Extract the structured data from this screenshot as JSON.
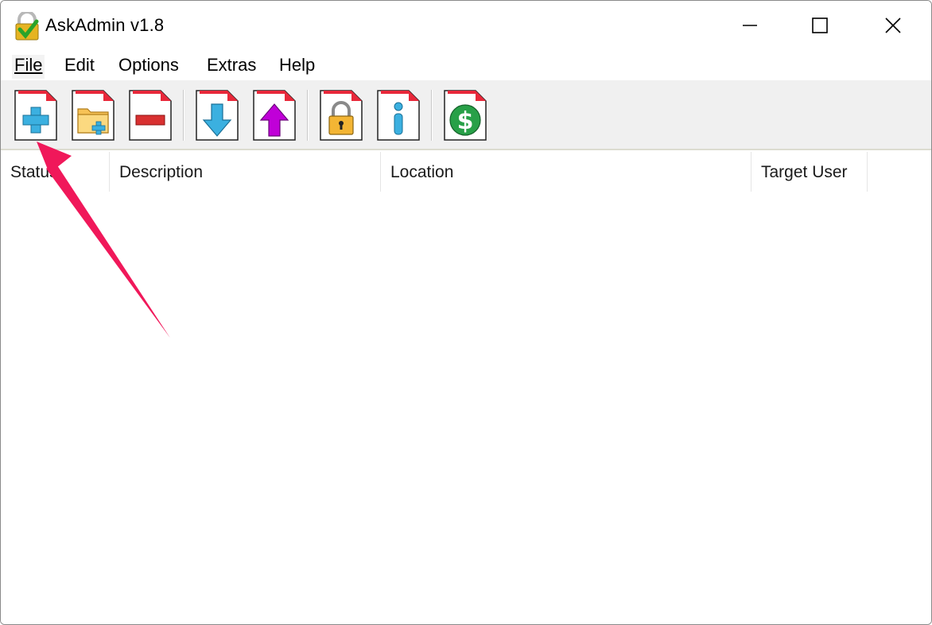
{
  "window": {
    "title": "AskAdmin v1.8",
    "controls": {
      "minimize": "minimize",
      "maximize": "maximize",
      "close": "close"
    }
  },
  "menu": {
    "items": [
      "File",
      "Edit",
      "Options",
      "Extras",
      "Help"
    ]
  },
  "toolbar": {
    "buttons": [
      {
        "icon": "add-file-icon",
        "color": "#3bb0e0"
      },
      {
        "icon": "add-folder-icon",
        "color": "#f0b040"
      },
      {
        "icon": "remove-icon",
        "color": "#d83030"
      },
      {
        "icon": "move-down-icon",
        "color": "#3bb0e0"
      },
      {
        "icon": "move-up-icon",
        "color": "#c000d8"
      },
      {
        "icon": "lock-icon",
        "color": "#f0a020"
      },
      {
        "icon": "info-icon",
        "color": "#3bb0e0"
      },
      {
        "icon": "donate-dollar-icon",
        "color": "#28a048"
      }
    ]
  },
  "list": {
    "columns": [
      "Status",
      "Description",
      "Location",
      "Target User"
    ],
    "rows": []
  },
  "annotation": {
    "arrow_color": "#f0185a"
  }
}
